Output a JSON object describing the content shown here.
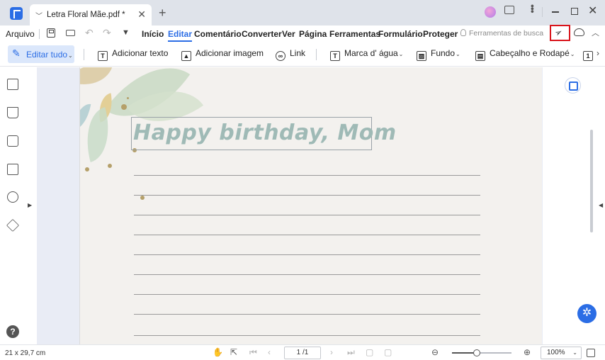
{
  "titlebar": {
    "tab_title": "Letra Floral Mãe.pdf *",
    "close_glyph": "✕",
    "new_tab_glyph": "+"
  },
  "menubar": {
    "file_label": "Arquivo",
    "items": [
      "Início",
      "Editar",
      "Comentário",
      "Converter",
      "Ver",
      "Página",
      "Ferramentas",
      "Formulário",
      "Proteger"
    ],
    "active_item": "Editar",
    "search_tools_label": "Ferramentas de busca"
  },
  "toolbar": {
    "edit_all_label": "Editar tudo",
    "add_text_label": "Adicionar texto",
    "add_image_label": "Adicionar imagem",
    "link_label": "Link",
    "watermark_label": "Marca d' água",
    "background_label": "Fundo",
    "header_footer_label": "Cabeçalho e Rodapé"
  },
  "document": {
    "greeting_text": "Happy birthday, Mom",
    "ruled_lines": 9
  },
  "statusbar": {
    "page_size": "21 x 29,7 cm",
    "page_indicator": "1 /1",
    "zoom_label": "100%",
    "zoom_fraction": 0.42
  },
  "colors": {
    "accent": "#2b6de5",
    "highlight_box": "#d9141b",
    "greeting_text": "#9fbab6"
  },
  "icons": [
    "app-logo-icon",
    "save-icon",
    "print-icon",
    "undo-icon",
    "redo-icon",
    "send-icon",
    "cloud-upload-icon",
    "thumbnails-icon",
    "bookmark-icon",
    "comment-icon",
    "attachment-icon",
    "search-icon",
    "layers-icon",
    "help-icon",
    "ocr-icon",
    "assistant-icon"
  ]
}
